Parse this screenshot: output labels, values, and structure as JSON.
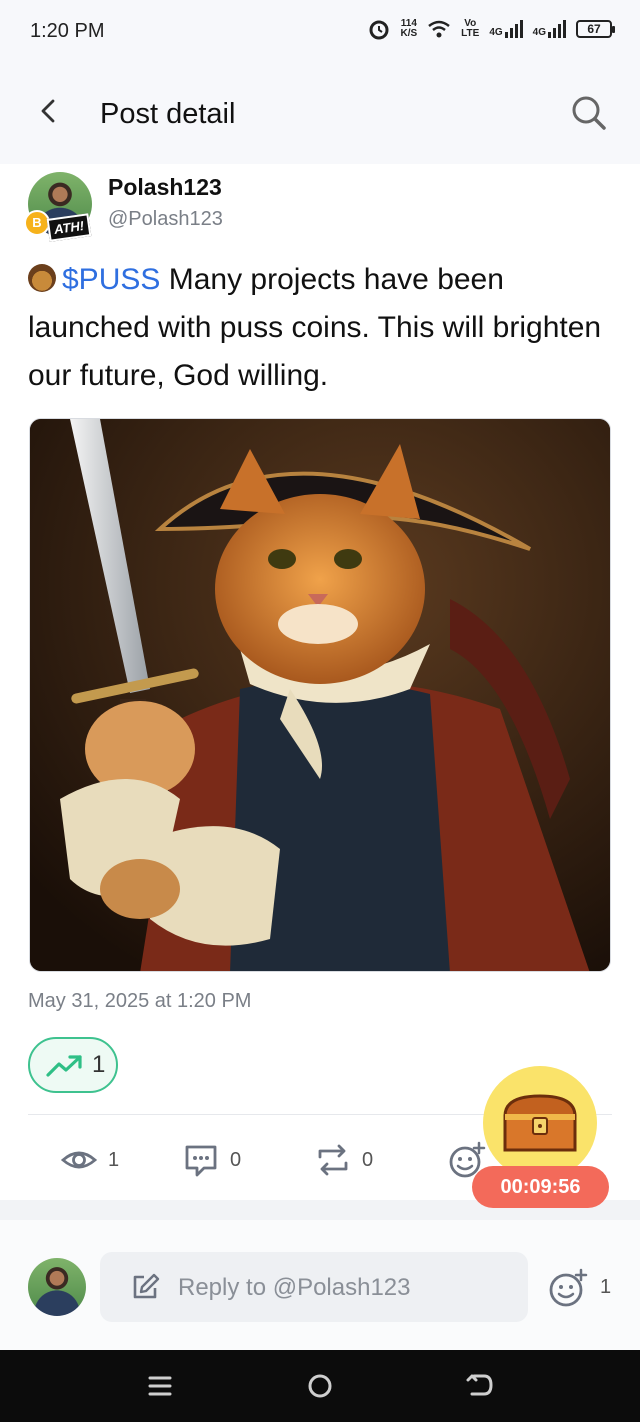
{
  "status_bar": {
    "time": "1:20 PM",
    "net_speed_value": "114",
    "net_speed_unit": "K/S",
    "volte_top": "Vo",
    "volte_bottom": "LTE",
    "signal1_label": "4G",
    "signal2_label": "4G",
    "battery": "67"
  },
  "header": {
    "title": "Post detail",
    "back_icon": "chevron-left-icon",
    "search_icon": "search-icon"
  },
  "post": {
    "author_name": "Polash123",
    "author_handle": "@Polash123",
    "badge_text": "ATH!",
    "coin_badge": "B",
    "ticker": "$PUSS",
    "text": " Many projects have been launched with puss coins. This will brighten our future, God willing.",
    "timestamp": "May 31, 2025 at 1:20 PM",
    "trend_count": "1"
  },
  "actions": {
    "views": "1",
    "comments": "0",
    "reposts": "0"
  },
  "reply": {
    "placeholder": "Reply to @Polash123",
    "reaction_count": "1"
  },
  "reward": {
    "timer": "00:09:56"
  },
  "colors": {
    "accent_link": "#2f6fe0",
    "trend_green": "#3ec28f",
    "timer_red": "#f36a5a",
    "fab_yellow": "#fae36a"
  }
}
